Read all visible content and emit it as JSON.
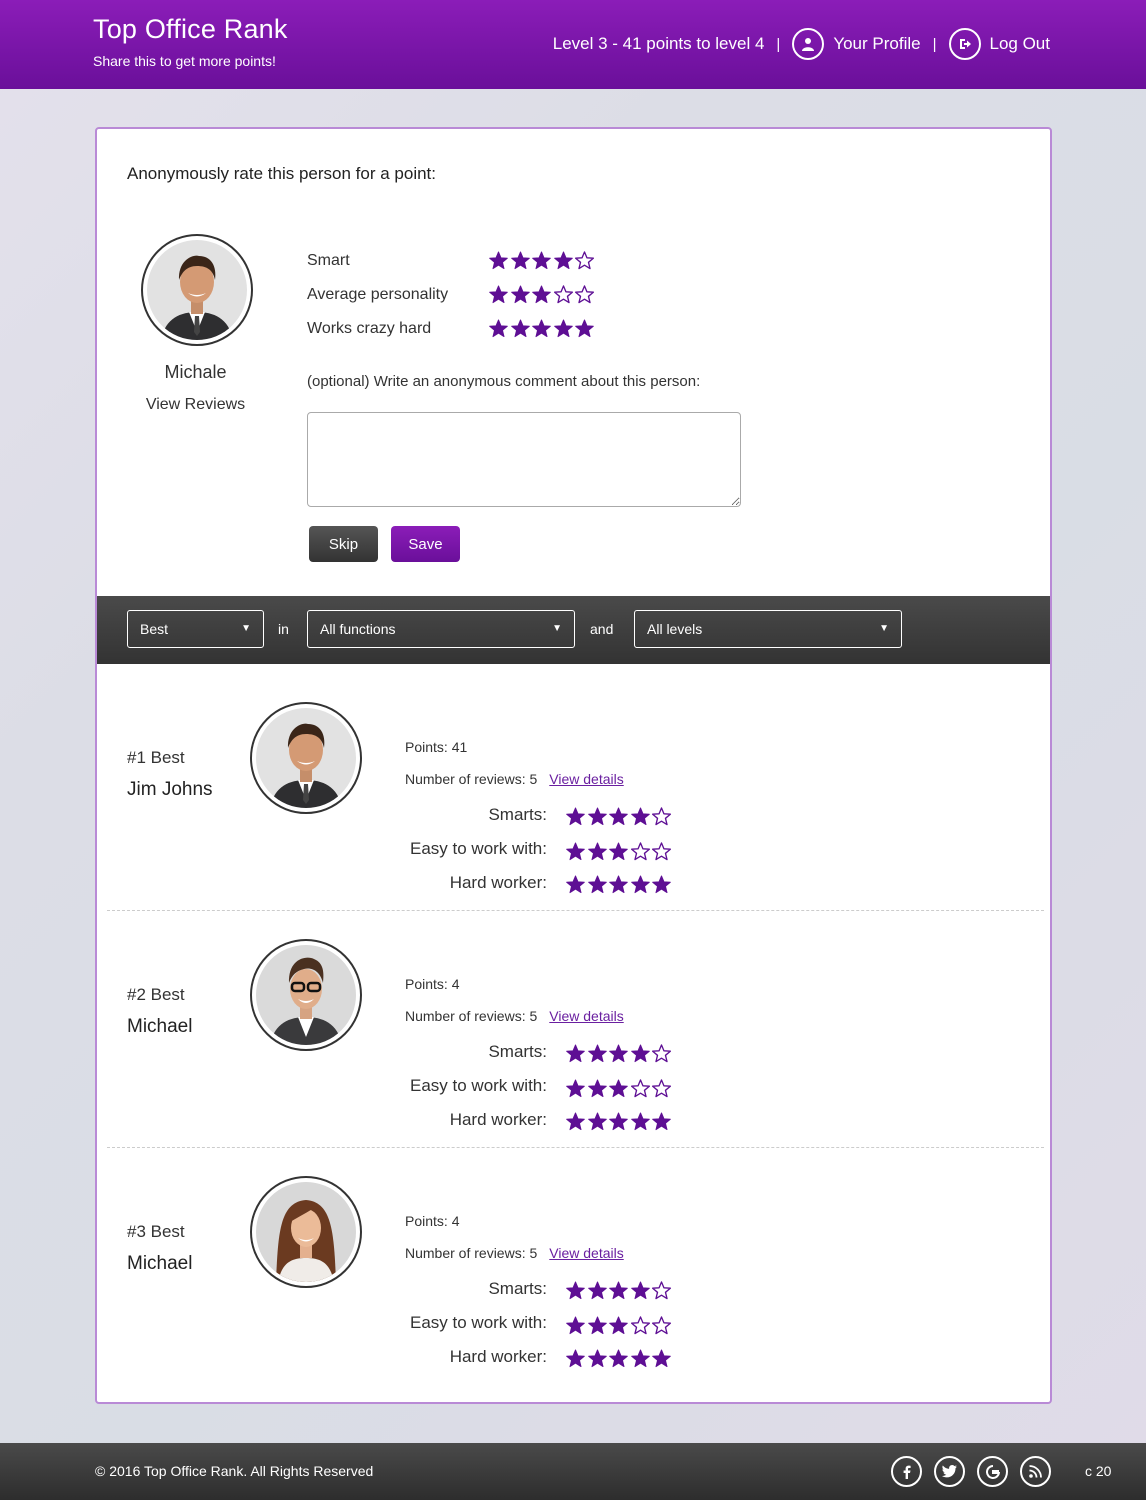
{
  "header": {
    "title": "Top Office Rank",
    "subtitle": "Share this to get more points!",
    "level_text": "Level 3 - 41 points to level 4",
    "separator": "|",
    "profile_label": "Your Profile",
    "logout_label": "Log Out"
  },
  "rate": {
    "heading": "Anonymously rate this person for a point:",
    "name": "Michale",
    "view_reviews": "View Reviews",
    "criteria": [
      {
        "label": "Smart",
        "rating": 4
      },
      {
        "label": "Average personality",
        "rating": 3
      },
      {
        "label": "Works crazy hard",
        "rating": 5
      }
    ],
    "comment_label": "(optional) Write an anonymous comment about this person:",
    "comment_value": "",
    "skip_label": "Skip",
    "save_label": "Save"
  },
  "filters": {
    "sort": "Best",
    "word_in": "in",
    "function": "All functions",
    "word_and": "and",
    "level": "All levels"
  },
  "ranking": [
    {
      "rank": "#1 Best",
      "name": "Jim Johns",
      "points": "Points: 41",
      "reviews": "Number of reviews: 5",
      "details": "View details",
      "metrics": [
        {
          "label": "Smarts:",
          "rating": 4
        },
        {
          "label": "Easy to work with:",
          "rating": 3
        },
        {
          "label": "Hard worker:",
          "rating": 5
        }
      ]
    },
    {
      "rank": "#2 Best",
      "name": "Michael",
      "points": "Points: 4",
      "reviews": "Number of reviews: 5",
      "details": "View details",
      "metrics": [
        {
          "label": "Smarts:",
          "rating": 4
        },
        {
          "label": "Easy to work with:",
          "rating": 3
        },
        {
          "label": "Hard worker:",
          "rating": 5
        }
      ]
    },
    {
      "rank": "#3 Best",
      "name": "Michael",
      "points": "Points: 4",
      "reviews": "Number of reviews: 5",
      "details": "View details",
      "metrics": [
        {
          "label": "Smarts:",
          "rating": 4
        },
        {
          "label": "Easy to work with:",
          "rating": 3
        },
        {
          "label": "Hard worker:",
          "rating": 5
        }
      ]
    }
  ],
  "footer": {
    "copyright": "© 2016 Top Office Rank. All Rights Reserved",
    "social": [
      "facebook-icon",
      "twitter-icon",
      "google-icon",
      "rss-icon"
    ],
    "counter": "c 20"
  },
  "colors": {
    "accent": "#6a0f9a",
    "star": "#5e0f94"
  }
}
